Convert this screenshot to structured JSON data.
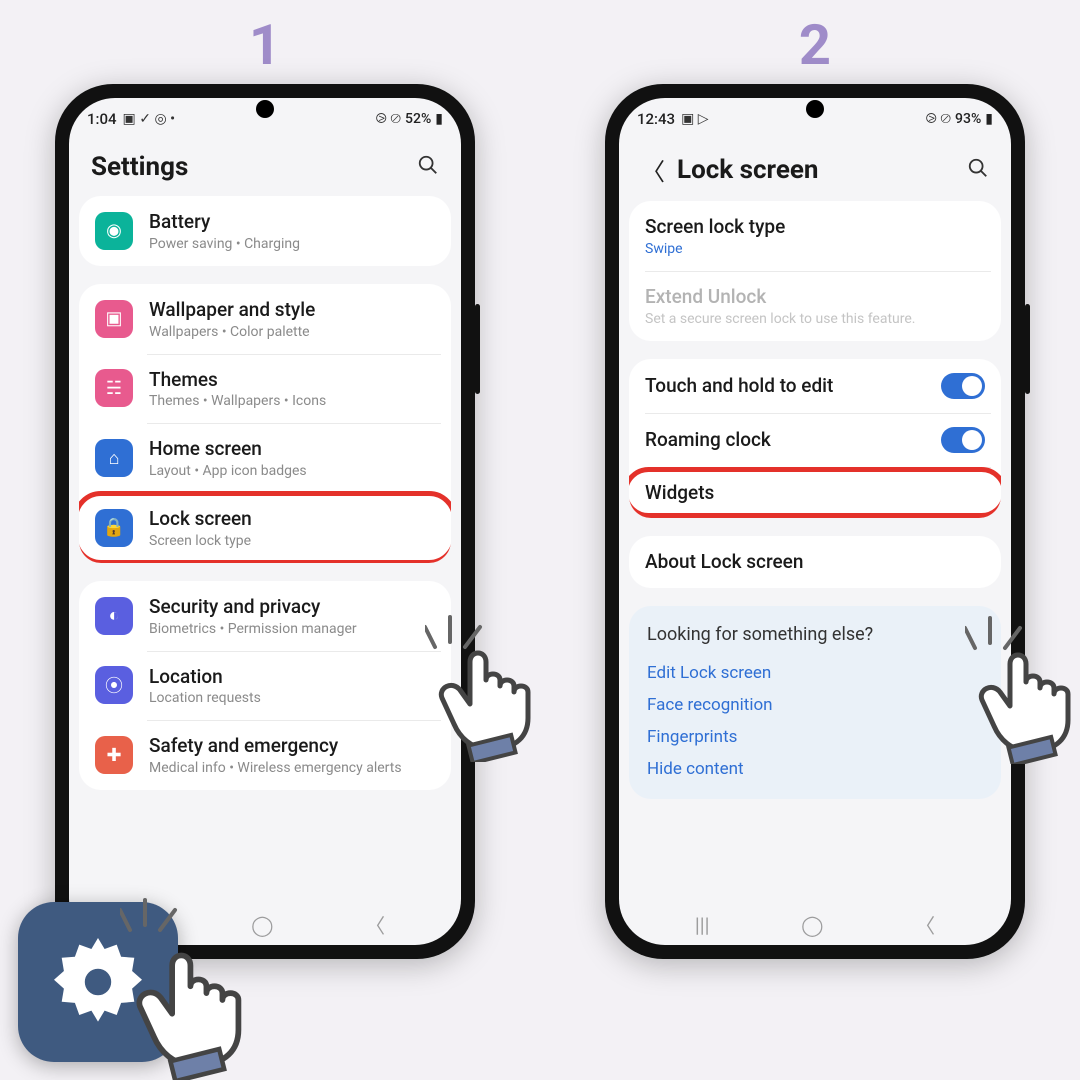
{
  "steps": {
    "one": "1",
    "two": "2"
  },
  "phone1": {
    "status": {
      "time": "1:04",
      "battery": "52%",
      "icons": "▣ ✓ ◎ •",
      "right_icons": "⧁ ⊘"
    },
    "header": {
      "title": "Settings"
    },
    "groups": [
      {
        "items": [
          {
            "icon": "battery-icon",
            "color": "#0bb39a",
            "title": "Battery",
            "sub": "Power saving  •  Charging"
          }
        ]
      },
      {
        "items": [
          {
            "icon": "wallpaper-icon",
            "color": "#e85a8e",
            "title": "Wallpaper and style",
            "sub": "Wallpapers  •  Color palette"
          },
          {
            "icon": "themes-icon",
            "color": "#e85a8e",
            "title": "Themes",
            "sub": "Themes  •  Wallpapers  •  Icons"
          },
          {
            "icon": "home-icon",
            "color": "#2f6fd4",
            "title": "Home screen",
            "sub": "Layout  •  App icon badges"
          },
          {
            "icon": "lock-icon",
            "color": "#2f6fd4",
            "title": "Lock screen",
            "sub": "Screen lock type",
            "highlight": true
          }
        ]
      },
      {
        "items": [
          {
            "icon": "shield-icon",
            "color": "#5a5fe0",
            "title": "Security and privacy",
            "sub": "Biometrics  •  Permission manager"
          },
          {
            "icon": "location-icon",
            "color": "#5a5fe0",
            "title": "Location",
            "sub": "Location requests"
          },
          {
            "icon": "emergency-icon",
            "color": "#e8614a",
            "title": "Safety and emergency",
            "sub": "Medical info  •  Wireless emergency alerts"
          }
        ]
      }
    ]
  },
  "phone2": {
    "status": {
      "time": "12:43",
      "battery": "93%",
      "icons": "▣ ▷",
      "right_icons": "⧁ ⊘"
    },
    "header": {
      "title": "Lock screen"
    },
    "group1": [
      {
        "title": "Screen lock type",
        "sub": "Swipe",
        "sub_link": true
      },
      {
        "title": "Extend Unlock",
        "sub": "Set a secure screen lock to use this feature.",
        "disabled": true
      }
    ],
    "group2": [
      {
        "title": "Touch and hold to edit",
        "toggle": true
      },
      {
        "title": "Roaming clock",
        "toggle": true
      },
      {
        "title": "Widgets",
        "highlight": true
      }
    ],
    "group3": [
      {
        "title": "About Lock screen"
      }
    ],
    "suggest": {
      "title": "Looking for something else?",
      "links": [
        "Edit Lock screen",
        "Face recognition",
        "Fingerprints",
        "Hide content"
      ]
    }
  }
}
